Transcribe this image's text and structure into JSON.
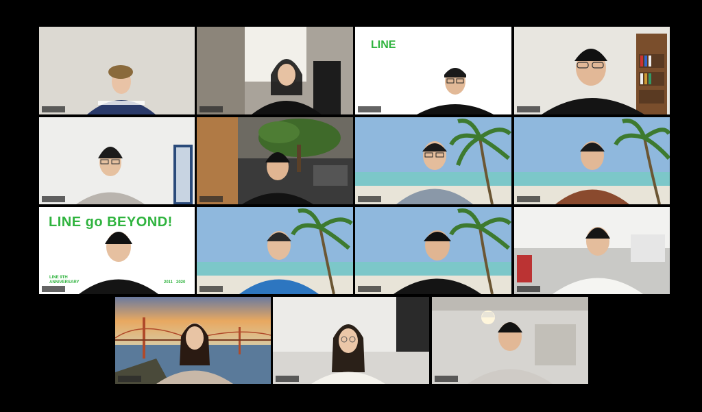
{
  "meeting": {
    "participant_count": "15",
    "tiles": [
      {
        "id": "p1",
        "background": "plain-wall"
      },
      {
        "id": "p2",
        "background": "office-curtain"
      },
      {
        "id": "p3",
        "background": "line-logo",
        "logo_text": "LINE"
      },
      {
        "id": "p4",
        "background": "room-bookshelf"
      },
      {
        "id": "p5",
        "background": "plain-room"
      },
      {
        "id": "p6",
        "background": "office-tree"
      },
      {
        "id": "p7",
        "background": "beach-palm"
      },
      {
        "id": "p8",
        "background": "beach-palm"
      },
      {
        "id": "p9",
        "background": "line-beyond",
        "headline": "LINE go BEYOND!",
        "footer_left": "LINE 9TH ANNIVERSARY",
        "footer_right_a": "2011",
        "footer_right_b": "2020"
      },
      {
        "id": "p10",
        "background": "beach-palm"
      },
      {
        "id": "p11",
        "background": "beach-palm"
      },
      {
        "id": "p12",
        "background": "bright-office"
      },
      {
        "id": "p13",
        "background": "golden-gate"
      },
      {
        "id": "p14",
        "background": "white-room"
      },
      {
        "id": "p15",
        "background": "ceiling-lamp"
      }
    ]
  },
  "colors": {
    "line_green": "#2fb33e",
    "sky": "#8fb8dd",
    "sea": "#7cc7c9",
    "sand": "#e8e4d8"
  }
}
